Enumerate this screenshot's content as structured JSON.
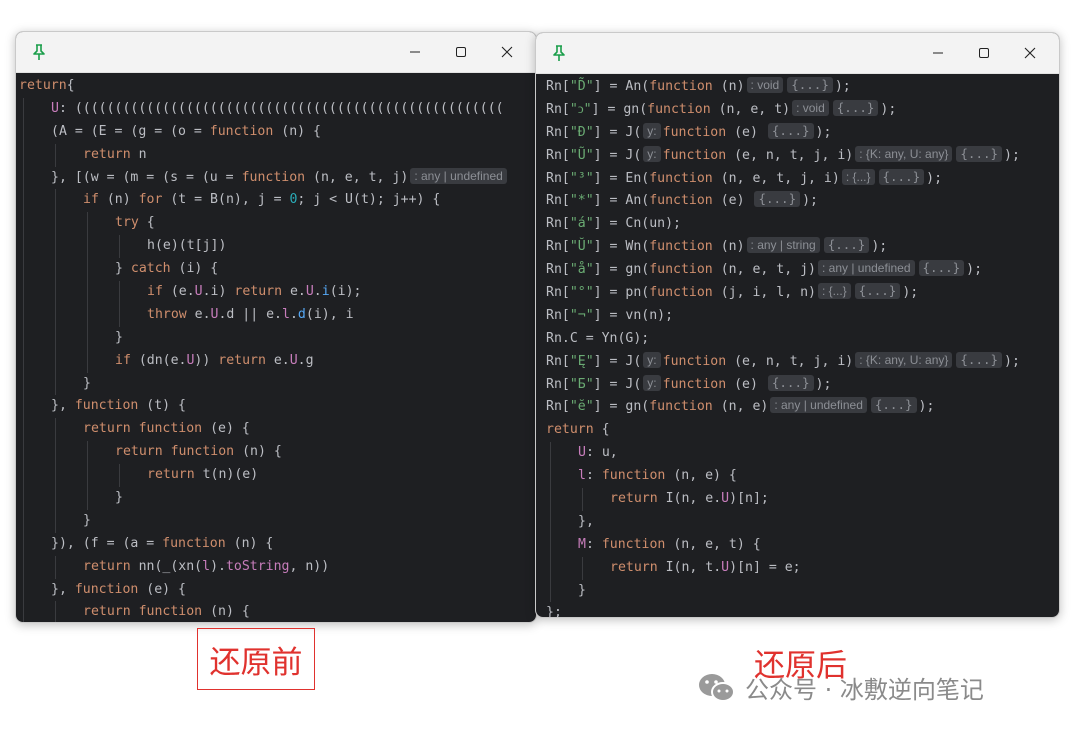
{
  "left_window": {
    "controls": {
      "minimize": "—",
      "maximize": "☐",
      "close": "✕"
    },
    "lines": [
      {
        "indent": 0,
        "tokens": [
          [
            "kw",
            "return"
          ],
          [
            "",
            "{"
          ]
        ]
      },
      {
        "indent": 2,
        "tokens": [
          [
            "prop",
            "U"
          ],
          [
            "",
            ": (((((((((((((((((((((((((((((((((((((((((((((((((((((("
          ]
        ]
      },
      {
        "indent": 2,
        "tokens": [
          [
            "",
            "(A = (E = (g = (o = "
          ],
          [
            "kw",
            "function"
          ],
          [
            "",
            " (n) {"
          ]
        ]
      },
      {
        "indent": 4,
        "tokens": [
          [
            "kw",
            "return"
          ],
          [
            "",
            " n"
          ]
        ]
      },
      {
        "indent": 2,
        "tokens": [
          [
            "",
            "}, [(w = (m = (s = (u = "
          ],
          [
            "kw",
            "function"
          ],
          [
            "",
            " (n, e, t, j)"
          ],
          [
            "hint",
            ": any | undefined"
          ]
        ]
      },
      {
        "indent": 4,
        "tokens": [
          [
            "kw",
            "if"
          ],
          [
            "",
            " (n) "
          ],
          [
            "kw",
            "for"
          ],
          [
            "",
            " (t = B(n), j = "
          ],
          [
            "num",
            "0"
          ],
          [
            "",
            "; j < U(t); j++) {"
          ]
        ]
      },
      {
        "indent": 6,
        "tokens": [
          [
            "kw",
            "try"
          ],
          [
            "",
            " {"
          ]
        ]
      },
      {
        "indent": 8,
        "tokens": [
          [
            "",
            "h(e)(t[j])"
          ]
        ]
      },
      {
        "indent": 6,
        "tokens": [
          [
            "",
            "} "
          ],
          [
            "kw",
            "catch"
          ],
          [
            "",
            " (i) {"
          ]
        ]
      },
      {
        "indent": 8,
        "tokens": [
          [
            "kw",
            "if"
          ],
          [
            "",
            " (e."
          ],
          [
            "prop",
            "U"
          ],
          [
            "",
            ".i) "
          ],
          [
            "kw",
            "return"
          ],
          [
            "",
            " e."
          ],
          [
            "prop",
            "U"
          ],
          [
            "",
            "."
          ],
          [
            "fn",
            "i"
          ],
          [
            "",
            "(i);"
          ]
        ]
      },
      {
        "indent": 8,
        "tokens": [
          [
            "kw",
            "throw"
          ],
          [
            "",
            " e."
          ],
          [
            "prop",
            "U"
          ],
          [
            "",
            ".d || e."
          ],
          [
            "prop",
            "l"
          ],
          [
            "",
            "."
          ],
          [
            "fn",
            "d"
          ],
          [
            "",
            "(i), i"
          ]
        ]
      },
      {
        "indent": 6,
        "tokens": [
          [
            "",
            "}"
          ]
        ]
      },
      {
        "indent": 6,
        "tokens": [
          [
            "kw",
            "if"
          ],
          [
            "",
            " (dn(e."
          ],
          [
            "prop",
            "U"
          ],
          [
            "",
            ")) "
          ],
          [
            "kw",
            "return"
          ],
          [
            "",
            " e."
          ],
          [
            "prop",
            "U"
          ],
          [
            "",
            ".g"
          ]
        ]
      },
      {
        "indent": 4,
        "tokens": [
          [
            "",
            "}"
          ]
        ]
      },
      {
        "indent": 2,
        "tokens": [
          [
            "",
            "}, "
          ],
          [
            "kw",
            "function"
          ],
          [
            "",
            " (t) {"
          ]
        ]
      },
      {
        "indent": 4,
        "tokens": [
          [
            "kw",
            "return"
          ],
          [
            "",
            " "
          ],
          [
            "kw",
            "function"
          ],
          [
            "",
            " (e) {"
          ]
        ]
      },
      {
        "indent": 6,
        "tokens": [
          [
            "kw",
            "return"
          ],
          [
            "",
            " "
          ],
          [
            "kw",
            "function"
          ],
          [
            "",
            " (n) {"
          ]
        ]
      },
      {
        "indent": 8,
        "tokens": [
          [
            "kw",
            "return"
          ],
          [
            "",
            " t(n)(e)"
          ]
        ]
      },
      {
        "indent": 6,
        "tokens": [
          [
            "",
            "}"
          ]
        ]
      },
      {
        "indent": 4,
        "tokens": [
          [
            "",
            "}"
          ]
        ]
      },
      {
        "indent": 2,
        "tokens": [
          [
            "",
            "}), (f = (a = "
          ],
          [
            "kw",
            "function"
          ],
          [
            "",
            " (n) {"
          ]
        ]
      },
      {
        "indent": 4,
        "tokens": [
          [
            "kw",
            "return"
          ],
          [
            "",
            " nn(_(xn("
          ],
          [
            "prop",
            "l"
          ],
          [
            "",
            ")."
          ],
          [
            "prop",
            "toString"
          ],
          [
            "",
            ", n))"
          ]
        ]
      },
      {
        "indent": 2,
        "tokens": [
          [
            "",
            "}, "
          ],
          [
            "kw",
            "function"
          ],
          [
            "",
            " (e) {"
          ]
        ]
      },
      {
        "indent": 4,
        "tokens": [
          [
            "kw",
            "return"
          ],
          [
            "",
            " "
          ],
          [
            "kw",
            "function"
          ],
          [
            "",
            " (n) {"
          ]
        ]
      }
    ]
  },
  "right_window": {
    "controls": {
      "minimize": "—",
      "maximize": "☐",
      "close": "✕"
    },
    "lines": [
      {
        "indent": 0,
        "tokens": [
          [
            "",
            "Rn["
          ],
          [
            "str",
            "\"D̃\""
          ],
          [
            "",
            "] = An("
          ],
          [
            "kw",
            "function"
          ],
          [
            "",
            " (n)"
          ],
          [
            "hint",
            ": void"
          ],
          [
            "fold",
            "{...}"
          ],
          [
            "",
            ");"
          ]
        ]
      },
      {
        "indent": 0,
        "tokens": [
          [
            "",
            "Rn["
          ],
          [
            "str",
            "\"ↄ\""
          ],
          [
            "",
            "] = gn("
          ],
          [
            "kw",
            "function"
          ],
          [
            "",
            " (n, e, t)"
          ],
          [
            "hint",
            ": void"
          ],
          [
            "fold",
            "{...}"
          ],
          [
            "",
            ");"
          ]
        ]
      },
      {
        "indent": 0,
        "tokens": [
          [
            "",
            "Rn["
          ],
          [
            "str",
            "\"Ɖ\""
          ],
          [
            "",
            "] = J("
          ],
          [
            "hint",
            "y:"
          ],
          [
            "kw",
            "function"
          ],
          [
            "",
            " (e) "
          ],
          [
            "fold",
            "{...}"
          ],
          [
            "",
            ");"
          ]
        ]
      },
      {
        "indent": 0,
        "tokens": [
          [
            "",
            "Rn["
          ],
          [
            "str",
            "\"Ũ\""
          ],
          [
            "",
            "] = J("
          ],
          [
            "hint",
            "y:"
          ],
          [
            "kw",
            "function"
          ],
          [
            "",
            " (e, n, t, j, i)"
          ],
          [
            "hint",
            ": {K: any, U: any}"
          ],
          [
            "fold",
            "{...}"
          ],
          [
            "",
            ");"
          ]
        ]
      },
      {
        "indent": 0,
        "tokens": [
          [
            "",
            "Rn["
          ],
          [
            "str",
            "\"³\""
          ],
          [
            "",
            "] = En("
          ],
          [
            "kw",
            "function"
          ],
          [
            "",
            " (n, e, t, j, i)"
          ],
          [
            "hint",
            ": {...}"
          ],
          [
            "fold",
            "{...}"
          ],
          [
            "",
            ");"
          ]
        ]
      },
      {
        "indent": 0,
        "tokens": [
          [
            "",
            "Rn["
          ],
          [
            "str",
            "\"*\""
          ],
          [
            "",
            "] = An("
          ],
          [
            "kw",
            "function"
          ],
          [
            "",
            " (e) "
          ],
          [
            "fold",
            "{...}"
          ],
          [
            "",
            ");"
          ]
        ]
      },
      {
        "indent": 0,
        "tokens": [
          [
            "",
            "Rn["
          ],
          [
            "str",
            "\"á\""
          ],
          [
            "",
            "] = Cn(un);"
          ]
        ]
      },
      {
        "indent": 0,
        "tokens": [
          [
            "",
            "Rn["
          ],
          [
            "str",
            "\"Ŭ\""
          ],
          [
            "",
            "] = Wn("
          ],
          [
            "kw",
            "function"
          ],
          [
            "",
            " (n)"
          ],
          [
            "hint",
            ": any | string"
          ],
          [
            "fold",
            "{...}"
          ],
          [
            "",
            ");"
          ]
        ]
      },
      {
        "indent": 0,
        "tokens": [
          [
            "",
            "Rn["
          ],
          [
            "str",
            "\"å\""
          ],
          [
            "",
            "] = gn("
          ],
          [
            "kw",
            "function"
          ],
          [
            "",
            " (n, e, t, j)"
          ],
          [
            "hint",
            ": any | undefined"
          ],
          [
            "fold",
            "{...}"
          ],
          [
            "",
            ");"
          ]
        ]
      },
      {
        "indent": 0,
        "tokens": [
          [
            "",
            "Rn["
          ],
          [
            "str",
            "\"°\""
          ],
          [
            "",
            "] = pn("
          ],
          [
            "kw",
            "function"
          ],
          [
            "",
            " (j, i, l, n)"
          ],
          [
            "hint",
            ": {...}"
          ],
          [
            "fold",
            "{...}"
          ],
          [
            "",
            ");"
          ]
        ]
      },
      {
        "indent": 0,
        "tokens": [
          [
            "",
            "Rn["
          ],
          [
            "str",
            "\"¬\""
          ],
          [
            "",
            "] = vn(n);"
          ]
        ]
      },
      {
        "indent": 0,
        "tokens": [
          [
            "",
            "Rn.C = Yn(G);"
          ]
        ]
      },
      {
        "indent": 0,
        "tokens": [
          [
            "",
            "Rn["
          ],
          [
            "str",
            "\"Ę\""
          ],
          [
            "",
            "] = J("
          ],
          [
            "hint",
            "y:"
          ],
          [
            "kw",
            "function"
          ],
          [
            "",
            " (e, n, t, j, i)"
          ],
          [
            "hint",
            ": {K: any, U: any}"
          ],
          [
            "fold",
            "{...}"
          ],
          [
            "",
            ");"
          ]
        ]
      },
      {
        "indent": 0,
        "tokens": [
          [
            "",
            "Rn["
          ],
          [
            "str",
            "\"Ƃ\""
          ],
          [
            "",
            "] = J("
          ],
          [
            "hint",
            "y:"
          ],
          [
            "kw",
            "function"
          ],
          [
            "",
            " (e) "
          ],
          [
            "fold",
            "{...}"
          ],
          [
            "",
            ");"
          ]
        ]
      },
      {
        "indent": 0,
        "tokens": [
          [
            "",
            "Rn["
          ],
          [
            "str",
            "\"ĕ\""
          ],
          [
            "",
            "] = gn("
          ],
          [
            "kw",
            "function"
          ],
          [
            "",
            " (n, e)"
          ],
          [
            "hint",
            ": any | undefined"
          ],
          [
            "fold",
            "{...}"
          ],
          [
            "",
            ");"
          ]
        ]
      },
      {
        "indent": 0,
        "tokens": [
          [
            "kw",
            "return"
          ],
          [
            "",
            " {"
          ]
        ]
      },
      {
        "indent": 2,
        "tokens": [
          [
            "prop",
            "U"
          ],
          [
            "",
            ": u,"
          ]
        ]
      },
      {
        "indent": 2,
        "tokens": [
          [
            "prop",
            "l"
          ],
          [
            "",
            ": "
          ],
          [
            "kw",
            "function"
          ],
          [
            "",
            " (n, e) {"
          ]
        ]
      },
      {
        "indent": 4,
        "tokens": [
          [
            "kw",
            "return"
          ],
          [
            "",
            " I(n, e."
          ],
          [
            "prop",
            "U"
          ],
          [
            "",
            ")[n];"
          ]
        ]
      },
      {
        "indent": 2,
        "tokens": [
          [
            "",
            "},"
          ]
        ]
      },
      {
        "indent": 2,
        "tokens": [
          [
            "prop",
            "M"
          ],
          [
            "",
            ": "
          ],
          [
            "kw",
            "function"
          ],
          [
            "",
            " (n, e, t) {"
          ]
        ]
      },
      {
        "indent": 4,
        "tokens": [
          [
            "kw",
            "return"
          ],
          [
            "",
            " I(n, t."
          ],
          [
            "prop",
            "U"
          ],
          [
            "",
            ")[n] = e;"
          ]
        ]
      },
      {
        "indent": 2,
        "tokens": [
          [
            "",
            "}"
          ]
        ]
      },
      {
        "indent": 0,
        "tokens": [
          [
            "",
            "};"
          ]
        ]
      }
    ]
  },
  "labels": {
    "before": "还原前",
    "after": "还原后"
  },
  "watermark": {
    "text": "公众号 · 冰敷逆向笔记"
  },
  "colors": {
    "keyword": "#cf8e6d",
    "property": "#c77dbb",
    "number": "#2aacb8",
    "string": "#6aab73",
    "accent_red": "#e0322e"
  }
}
